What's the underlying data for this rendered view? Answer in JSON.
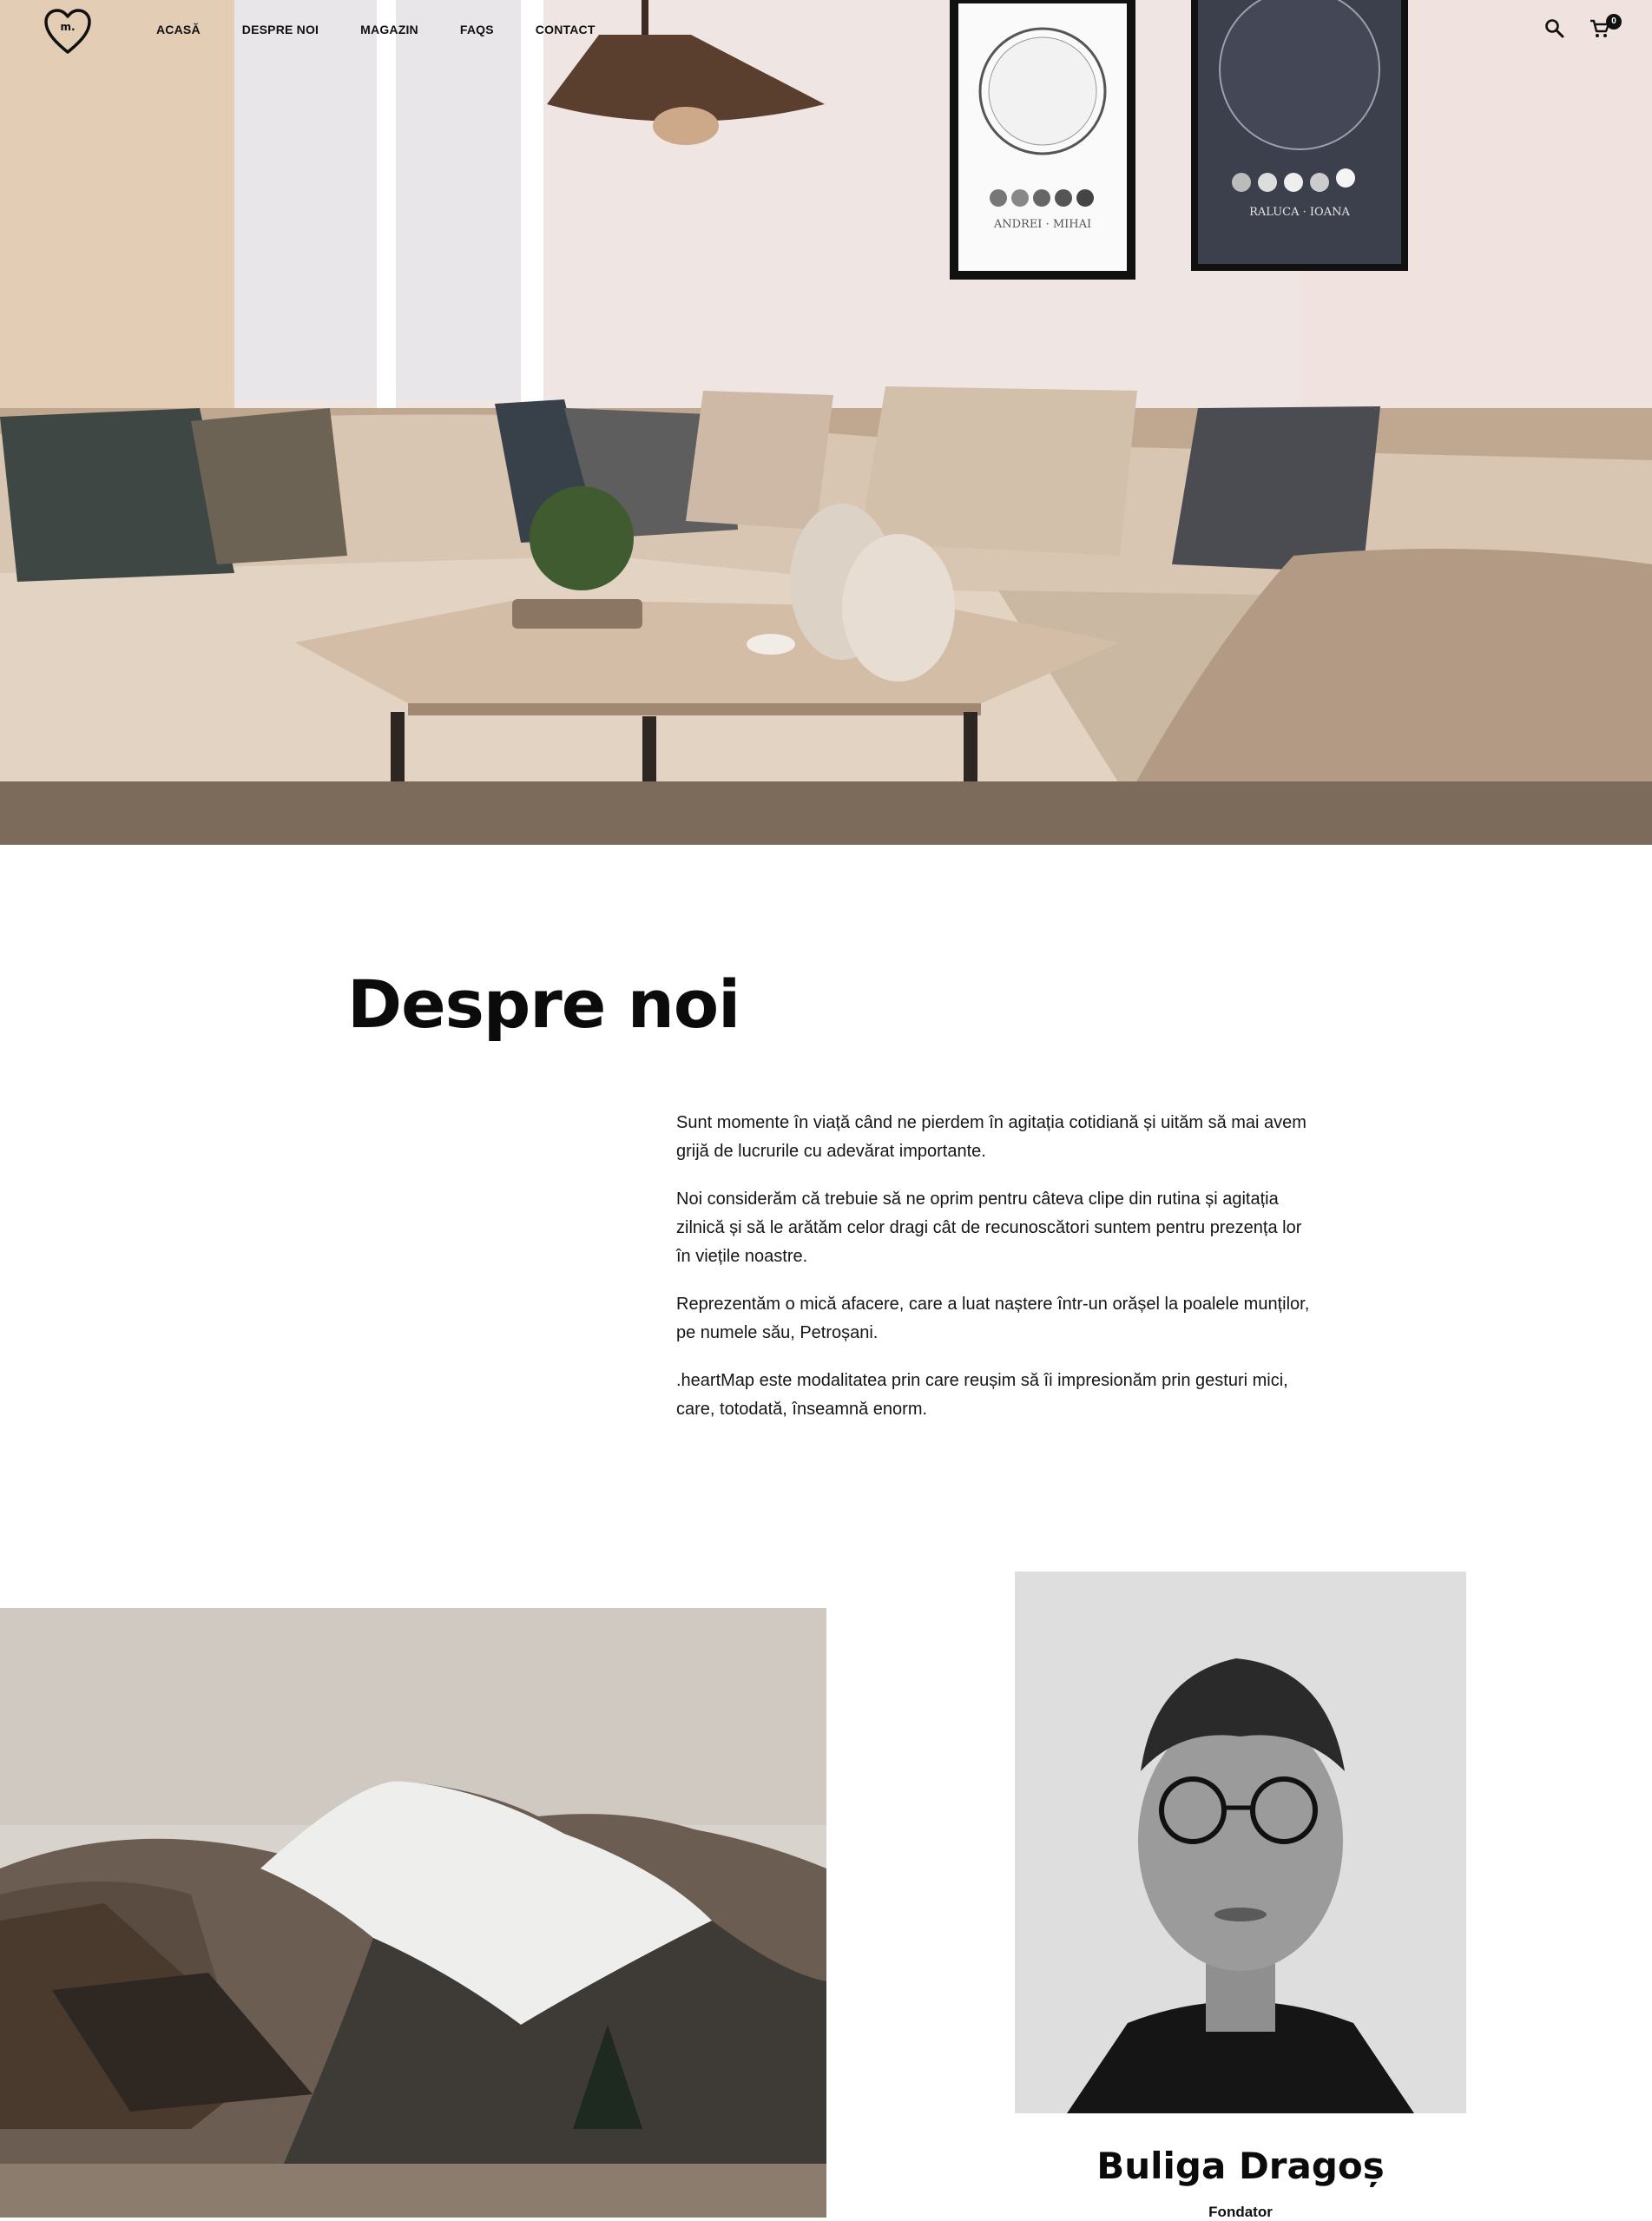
{
  "header": {
    "logo_text": "m.",
    "nav": [
      "ACASĂ",
      "DESPRE NOI",
      "MAGAZIN",
      "FAQS",
      "CONTACT"
    ],
    "cart_count": "0",
    "icons": [
      "heart-logo",
      "search-icon",
      "cart-icon"
    ]
  },
  "hero": {
    "poster_left": {
      "names": "ANDREI · MIHAI"
    },
    "poster_right": {
      "names": "RALUCA · IOANA"
    }
  },
  "about": {
    "title": "Despre noi",
    "paragraphs": [
      "Sunt momente în viață când ne pierdem în agitația cotidiană și uităm să mai avem grijă de lucrurile cu adevărat importante.",
      "Noi considerăm că trebuie să ne oprim pentru câteva clipe din rutina și agitația zilnică și să le arătăm celor dragi cât de recunoscători suntem pentru prezența lor în viețile noastre.",
      "Reprezentăm o mică afacere, care a luat naștere într-un orășel la poalele munților, pe numele său, Petroșani.",
      ".heartMap este modalitatea prin care reușim să îi impresionăm prin gesturi mici, care, totodată, înseamnă enorm."
    ]
  },
  "founder": {
    "name": "Buliga Dragoș",
    "role": "Fondator"
  }
}
